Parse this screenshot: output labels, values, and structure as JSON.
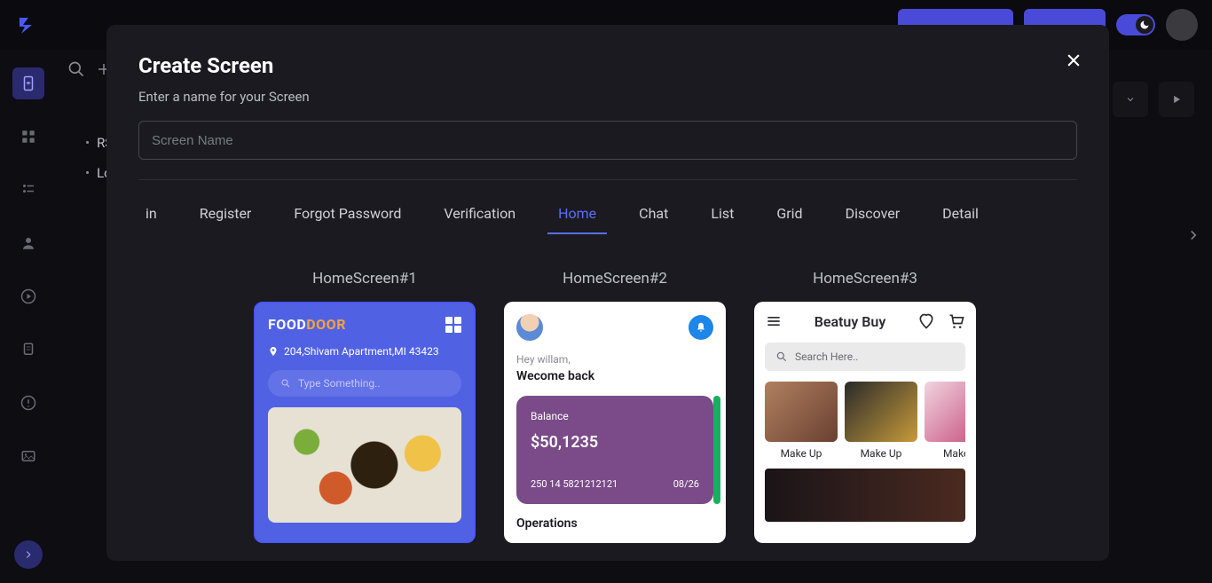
{
  "topbar": {
    "primary1": " ",
    "primary2": " "
  },
  "tree": {
    "items": [
      "RS...",
      "Lo..."
    ]
  },
  "modal": {
    "title": "Create Screen",
    "subtitle": "Enter a name for your Screen",
    "placeholder": "Screen Name",
    "tabs": [
      "in",
      "Register",
      "Forgot Password",
      "Verification",
      "Home",
      "Chat",
      "List",
      "Grid",
      "Discover",
      "Detail"
    ],
    "active_tab": "Home",
    "cards": [
      {
        "title": "HomeScreen#1",
        "logo_a": "FOOD",
        "logo_b": "DOOR",
        "address": "204,Shivam Apartment,MI 43423",
        "search_ph": "Type Something.."
      },
      {
        "title": "HomeScreen#2",
        "hello": "Hey willam,",
        "welcome": "Wecome back",
        "balance_label": "Balance",
        "balance_amount": "$50,1235",
        "card_num": "250 14 5821212121",
        "card_date": "08/26",
        "ops": "Operations"
      },
      {
        "title": "HomeScreen#3",
        "brand": "Beatuy Buy",
        "search_ph": "Search Here..",
        "cats": [
          "Make Up",
          "Make Up",
          "Make U"
        ]
      }
    ]
  }
}
